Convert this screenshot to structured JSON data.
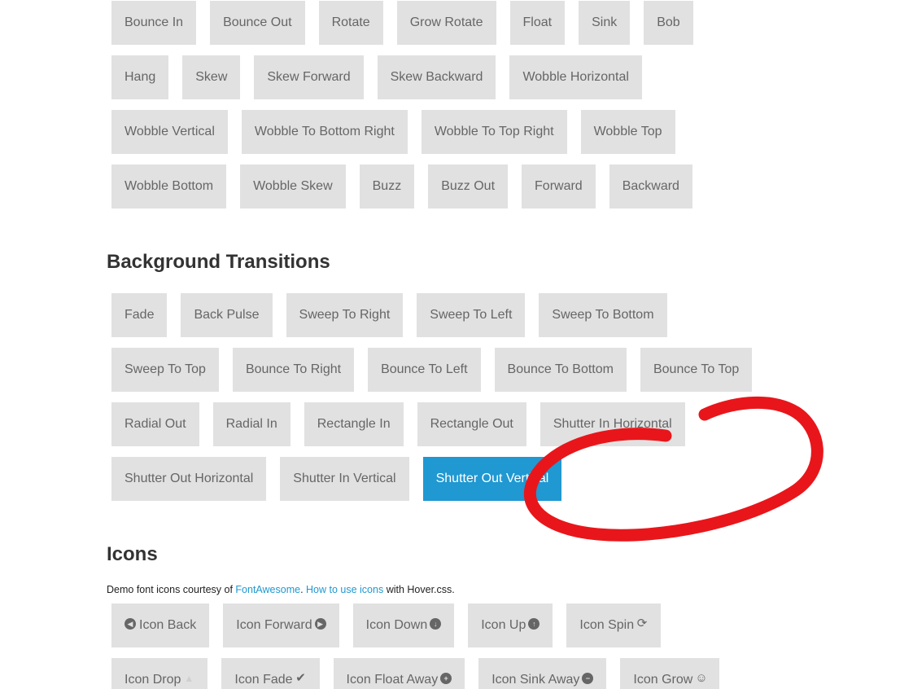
{
  "groups": {
    "transitions_2d": {
      "buttons": [
        "Bounce In",
        "Bounce Out",
        "Rotate",
        "Grow Rotate",
        "Float",
        "Sink",
        "Bob",
        "Hang",
        "Skew",
        "Skew Forward",
        "Skew Backward",
        "Wobble Horizontal",
        "Wobble Vertical",
        "Wobble To Bottom Right",
        "Wobble To Top Right",
        "Wobble Top",
        "Wobble Bottom",
        "Wobble Skew",
        "Buzz",
        "Buzz Out",
        "Forward",
        "Backward"
      ]
    },
    "background_transitions": {
      "title": "Background Transitions",
      "buttons": [
        "Fade",
        "Back Pulse",
        "Sweep To Right",
        "Sweep To Left",
        "Sweep To Bottom",
        "Sweep To Top",
        "Bounce To Right",
        "Bounce To Left",
        "Bounce To Bottom",
        "Bounce To Top",
        "Radial Out",
        "Radial In",
        "Rectangle In",
        "Rectangle Out",
        "Shutter In Horizontal",
        "Shutter Out Horizontal",
        "Shutter In Vertical",
        "Shutter Out Vertical"
      ],
      "active_button": "Shutter Out Vertical"
    },
    "icons": {
      "title": "Icons",
      "intro": {
        "prefix": "Demo font icons courtesy of ",
        "link1": "FontAwesome",
        "middle": ". ",
        "link2": "How to use icons",
        "suffix": " with Hover.css."
      },
      "buttons": [
        {
          "label": "Icon Back",
          "icon": "chevron-circle-left-icon",
          "glyph": "◀",
          "position": "left",
          "style": "circle"
        },
        {
          "label": "Icon Forward",
          "icon": "chevron-circle-right-icon",
          "glyph": "▶",
          "position": "right",
          "style": "circle"
        },
        {
          "label": "Icon Down",
          "icon": "arrow-circle-down-icon",
          "glyph": "↓",
          "position": "right",
          "style": "circle"
        },
        {
          "label": "Icon Up",
          "icon": "arrow-circle-up-icon",
          "glyph": "↑",
          "position": "right",
          "style": "circle"
        },
        {
          "label": "Icon Spin",
          "icon": "refresh-icon",
          "glyph": "⟳",
          "position": "right",
          "style": "plain"
        },
        {
          "label": "Icon Drop",
          "icon": "tint-icon",
          "glyph": "▲",
          "position": "right",
          "style": "faint"
        },
        {
          "label": "Icon Fade",
          "icon": "check-icon",
          "glyph": "✔",
          "position": "right",
          "style": "plain"
        },
        {
          "label": "Icon Float Away",
          "icon": "plus-circle-icon",
          "glyph": "+",
          "position": "right",
          "style": "circle"
        },
        {
          "label": "Icon Sink Away",
          "icon": "minus-circle-icon",
          "glyph": "−",
          "position": "right",
          "style": "circle"
        },
        {
          "label": "Icon Grow",
          "icon": "smile-icon",
          "glyph": "☺",
          "position": "right",
          "style": "plain"
        }
      ]
    }
  },
  "annotation": {
    "type": "hand-drawn circle",
    "color": "#e8161b",
    "target": "Shutter Out Vertical"
  },
  "colors": {
    "button_bg": "#e1e1e1",
    "button_text": "#666666",
    "accent": "#2098d1",
    "annotation": "#e8161b"
  }
}
